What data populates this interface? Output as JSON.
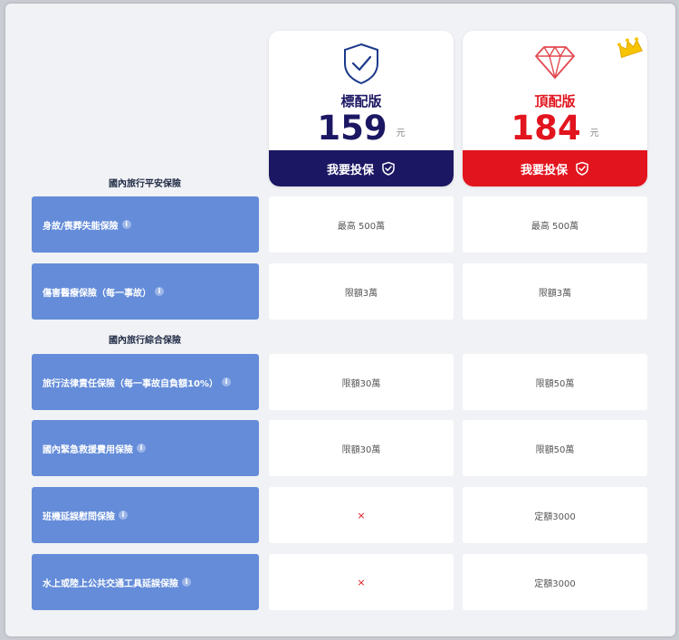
{
  "plans": [
    {
      "name": "標配版",
      "price": "159",
      "unit": "元",
      "button": "我要投保",
      "icon": "shield-check-icon",
      "color": "#1c1763"
    },
    {
      "name": "頂配版",
      "price": "184",
      "unit": "元",
      "button": "我要投保",
      "icon": "diamond-icon",
      "color": "#e2141e",
      "badge_icon": "crown-icon"
    }
  ],
  "sections": [
    {
      "title": "國內旅行平安保險",
      "rows": [
        {
          "label": "身故/喪葬失能保險",
          "std": "最高 500萬",
          "top": "最高 500萬"
        },
        {
          "label": "傷害醫療保險（每一事故）",
          "std": "限額3萬",
          "top": "限額3萬"
        }
      ]
    },
    {
      "title": "國內旅行綜合保險",
      "rows": [
        {
          "label": "旅行法律責任保險（每一事故自負額10%）",
          "std": "限額30萬",
          "top": "限額50萬"
        },
        {
          "label": "國內緊急救援費用保險",
          "std": "限額30萬",
          "top": "限額50萬"
        },
        {
          "label": "班機延誤慰問保險",
          "std": "×",
          "top": "定額3000"
        },
        {
          "label": "水上或陸上公共交通工具延誤保險",
          "std": "×",
          "top": "定額3000"
        }
      ]
    }
  ],
  "info_glyph": "i",
  "colors": {
    "label_bg": "#648cd9",
    "navy": "#1c1763",
    "red": "#e2141e"
  }
}
